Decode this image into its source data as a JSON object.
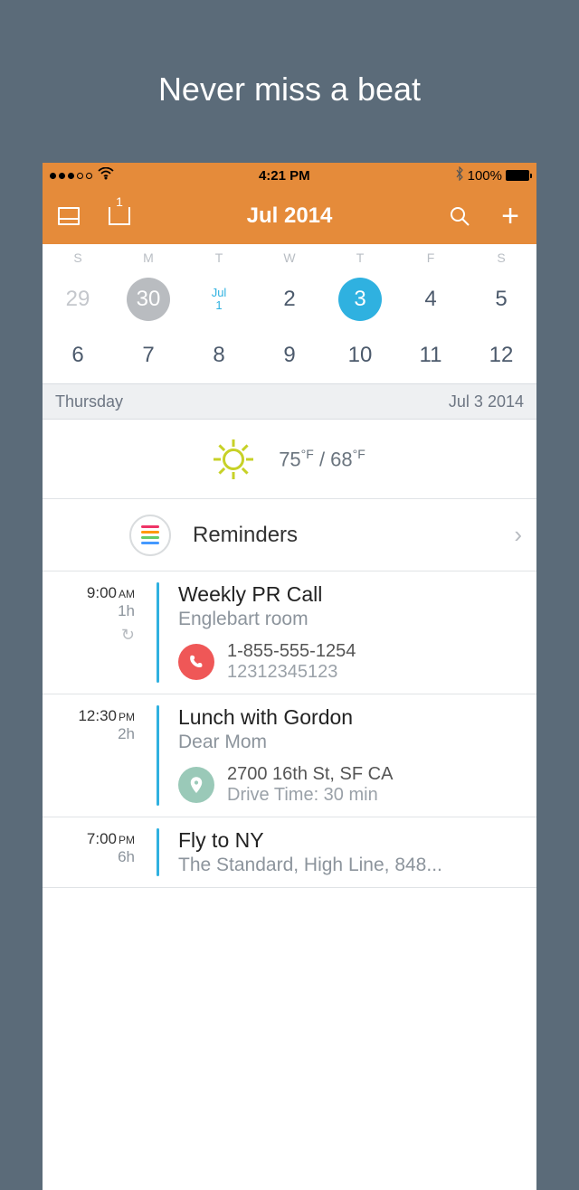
{
  "tagline": "Never miss a beat",
  "status": {
    "time": "4:21 PM",
    "battery": "100%"
  },
  "nav": {
    "share_badge": "1",
    "title": "Jul 2014"
  },
  "calendar": {
    "days_of_week": [
      "S",
      "M",
      "T",
      "W",
      "T",
      "F",
      "S"
    ],
    "month_stub_label": "Jul",
    "month_stub_day": "1",
    "row1": [
      "29",
      "30",
      "",
      "2",
      "3",
      "4",
      "5"
    ],
    "row2": [
      "6",
      "7",
      "8",
      "9",
      "10",
      "11",
      "12"
    ]
  },
  "section": {
    "day_name": "Thursday",
    "date": "Jul 3 2014"
  },
  "weather": {
    "high": "75",
    "high_unit": "°F",
    "sep": " / ",
    "low": "68",
    "low_unit": "°F"
  },
  "reminders": {
    "label": "Reminders"
  },
  "events": [
    {
      "time": "9:00",
      "ampm": "AM",
      "duration": "1h",
      "repeats": true,
      "title": "Weekly PR Call",
      "subtitle": "Englebart room",
      "extra_type": "phone",
      "line1": "1-855-555-1254",
      "line2": "12312345123"
    },
    {
      "time": "12:30",
      "ampm": "PM",
      "duration": "2h",
      "repeats": false,
      "title": "Lunch with Gordon",
      "subtitle": "Dear Mom",
      "extra_type": "location",
      "line1": "2700 16th St, SF CA",
      "line2": "Drive Time: 30 min"
    },
    {
      "time": "7:00",
      "ampm": "PM",
      "duration": "6h",
      "repeats": false,
      "title": "Fly to NY",
      "subtitle": "The Standard, High Line, 848..."
    }
  ]
}
